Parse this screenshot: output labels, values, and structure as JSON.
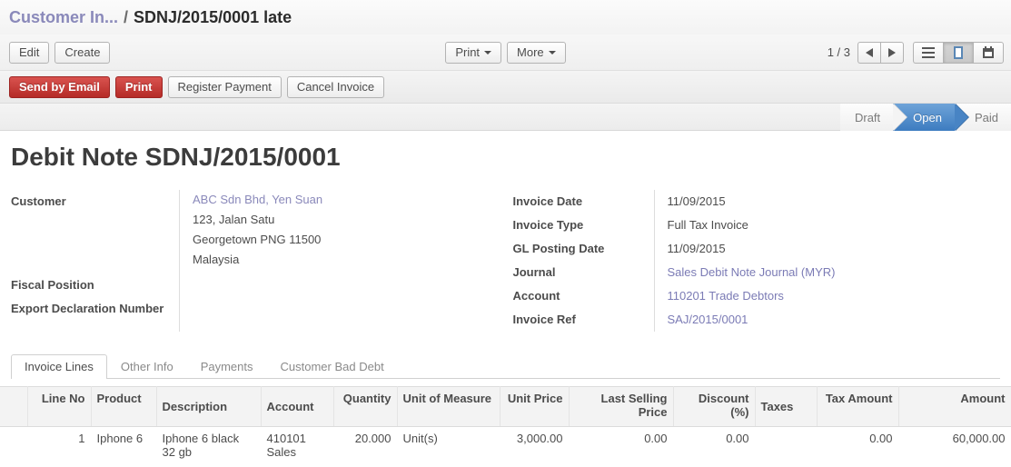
{
  "breadcrumb": {
    "parent": "Customer In...",
    "separator": "/",
    "current": "SDNJ/2015/0001 late"
  },
  "toolbar": {
    "edit_label": "Edit",
    "create_label": "Create",
    "print_label": "Print",
    "more_label": "More",
    "pager": "1 / 3",
    "prev_icon": "arrow-left-icon",
    "next_icon": "arrow-right-icon",
    "view_list_icon": "list-view-icon",
    "view_form_icon": "form-view-icon",
    "view_calendar_icon": "calendar-view-icon",
    "active_view": "form"
  },
  "actions": {
    "send_by_email": "Send by Email",
    "print": "Print",
    "register_payment": "Register Payment",
    "cancel_invoice": "Cancel Invoice"
  },
  "statusbar": {
    "states": [
      "Draft",
      "Open",
      "Paid"
    ],
    "active": "Open",
    "active_color": "#3d7cc0"
  },
  "record": {
    "title_prefix": "Debit Note",
    "title_number": "SDNJ/2015/0001"
  },
  "form": {
    "left": {
      "customer_label": "Customer",
      "customer_name": "ABC Sdn Bhd, Yen Suan",
      "customer_address": [
        "123, Jalan Satu",
        "Georgetown PNG 11500",
        "Malaysia"
      ],
      "fiscal_position_label": "Fiscal Position",
      "fiscal_position_value": "",
      "export_declaration_label": "Export Declaration Number",
      "export_declaration_value": ""
    },
    "right": {
      "invoice_date_label": "Invoice Date",
      "invoice_date_value": "11/09/2015",
      "invoice_type_label": "Invoice Type",
      "invoice_type_value": "Full Tax Invoice",
      "gl_posting_date_label": "GL Posting Date",
      "gl_posting_date_value": "11/09/2015",
      "journal_label": "Journal",
      "journal_value": "Sales Debit Note Journal (MYR)",
      "account_label": "Account",
      "account_value": "110201 Trade Debtors",
      "invoice_ref_label": "Invoice Ref",
      "invoice_ref_value": "SAJ/2015/0001"
    }
  },
  "tabs": [
    {
      "label": "Invoice Lines",
      "active": true
    },
    {
      "label": "Other Info",
      "active": false
    },
    {
      "label": "Payments",
      "active": false
    },
    {
      "label": "Customer Bad Debt",
      "active": false
    }
  ],
  "lines_table": {
    "columns": [
      "Line No",
      "Product",
      "Description",
      "Account",
      "Quantity",
      "Unit of Measure",
      "Unit Price",
      "Last Selling Price",
      "Discount (%)",
      "Taxes",
      "Tax Amount",
      "Amount"
    ],
    "rows": [
      {
        "line_no": "1",
        "product": "Iphone 6",
        "description": "Iphone 6 black 32 gb",
        "account": "410101 Sales",
        "quantity": "20.000",
        "unit_of_measure": "Unit(s)",
        "unit_price": "3,000.00",
        "last_selling_price": "0.00",
        "discount": "0.00",
        "taxes": "",
        "tax_amount": "0.00",
        "amount": "60,000.00"
      }
    ]
  }
}
